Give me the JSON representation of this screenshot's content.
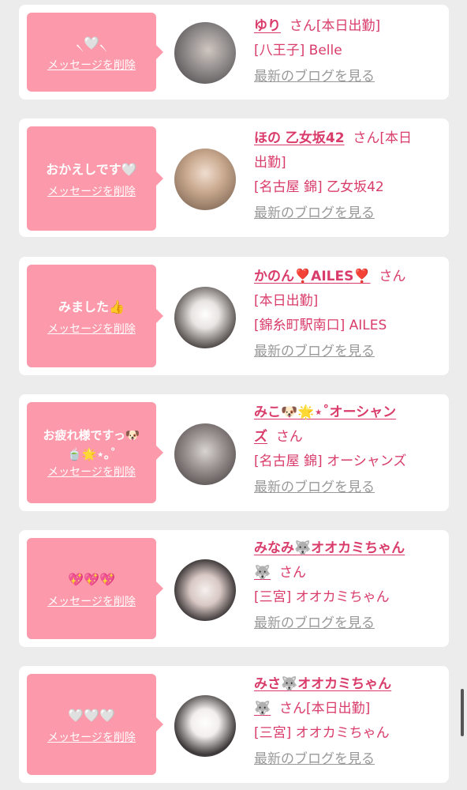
{
  "delete_label": "メッセージを削除",
  "san_label": "さん",
  "blog_label": "最新のブログを見る",
  "cards": [
    {
      "message": "🤍",
      "name_line1": "ゆり",
      "san_suffix": "[本日出勤]",
      "line2": "[八王子] Belle",
      "line3": ""
    },
    {
      "message": "おかえしです🤍",
      "name_line1": "ほの 乙女坂42",
      "san_suffix": "[本日",
      "line2": "出勤]",
      "line3": "[名古屋 錦] 乙女坂42"
    },
    {
      "message": "みました👍",
      "name_line1": "かのん❣️AILES❣️",
      "san_suffix": "",
      "line2": "[本日出勤]",
      "line3": "[錦糸町駅南口] AILES"
    },
    {
      "message_l1": "お疲れ様ですっ🐶",
      "message_l2": "🍵🌟⋆｡˚",
      "name_line1": "みこ🐶🌟⋆˚オーシャン",
      "name_line2": "ズ",
      "line3": "[名古屋 錦] オーシャンズ"
    },
    {
      "message": "💖💖💖",
      "name_line1": "みなみ🐺オオカミちゃん",
      "name_line2": "🐺",
      "line3": "[三宮] オオカミちゃん"
    },
    {
      "message": "🤍🤍🤍",
      "name_line1": "みさ🐺オオカミちゃん",
      "name_line2": "🐺",
      "san_suffix": "[本日出勤]",
      "line3": "[三宮] オオカミちゃん"
    }
  ]
}
